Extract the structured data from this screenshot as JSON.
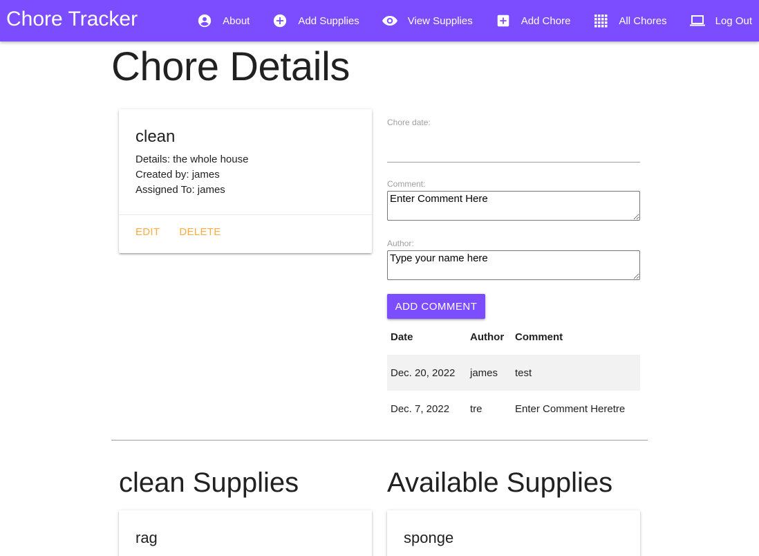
{
  "navbar": {
    "brand": "Chore Tracker",
    "items": [
      {
        "label": "About",
        "icon": "account-circle-icon"
      },
      {
        "label": "Add Supplies",
        "icon": "add-circle-icon"
      },
      {
        "label": "View Supplies",
        "icon": "eye-icon"
      },
      {
        "label": "Add Chore",
        "icon": "add-box-icon"
      },
      {
        "label": "All Chores",
        "icon": "grid-icon"
      },
      {
        "label": "Log Out",
        "icon": "laptop-icon"
      }
    ],
    "color": "#7c4dff"
  },
  "page": {
    "title": "Chore Details"
  },
  "chore": {
    "name": "clean",
    "details": "Details: the whole house",
    "created_by": "Created by: james",
    "assigned_to": "Assigned To: james",
    "edit_label": "Edit",
    "delete_label": "Delete",
    "action_color": "#ffab40"
  },
  "form": {
    "date_label": "Chore date:",
    "date_value": "",
    "comment_label": "Comment:",
    "comment_value": "Enter Comment Here",
    "author_label": "Author:",
    "author_value": "Type your name here",
    "submit_label": "Add Comment"
  },
  "comments": {
    "headers": [
      "Date",
      "Author",
      "Comment"
    ],
    "rows": [
      {
        "date": "Dec. 20, 2022",
        "author": "james",
        "comment": "test"
      },
      {
        "date": "Dec. 7, 2022",
        "author": "tre",
        "comment": "Enter Comment Heretre"
      }
    ]
  },
  "supplies": {
    "chore_title": "clean Supplies",
    "chore_items": [
      "rag"
    ],
    "available_title": "Available Supplies",
    "available_items": [
      "sponge"
    ]
  }
}
